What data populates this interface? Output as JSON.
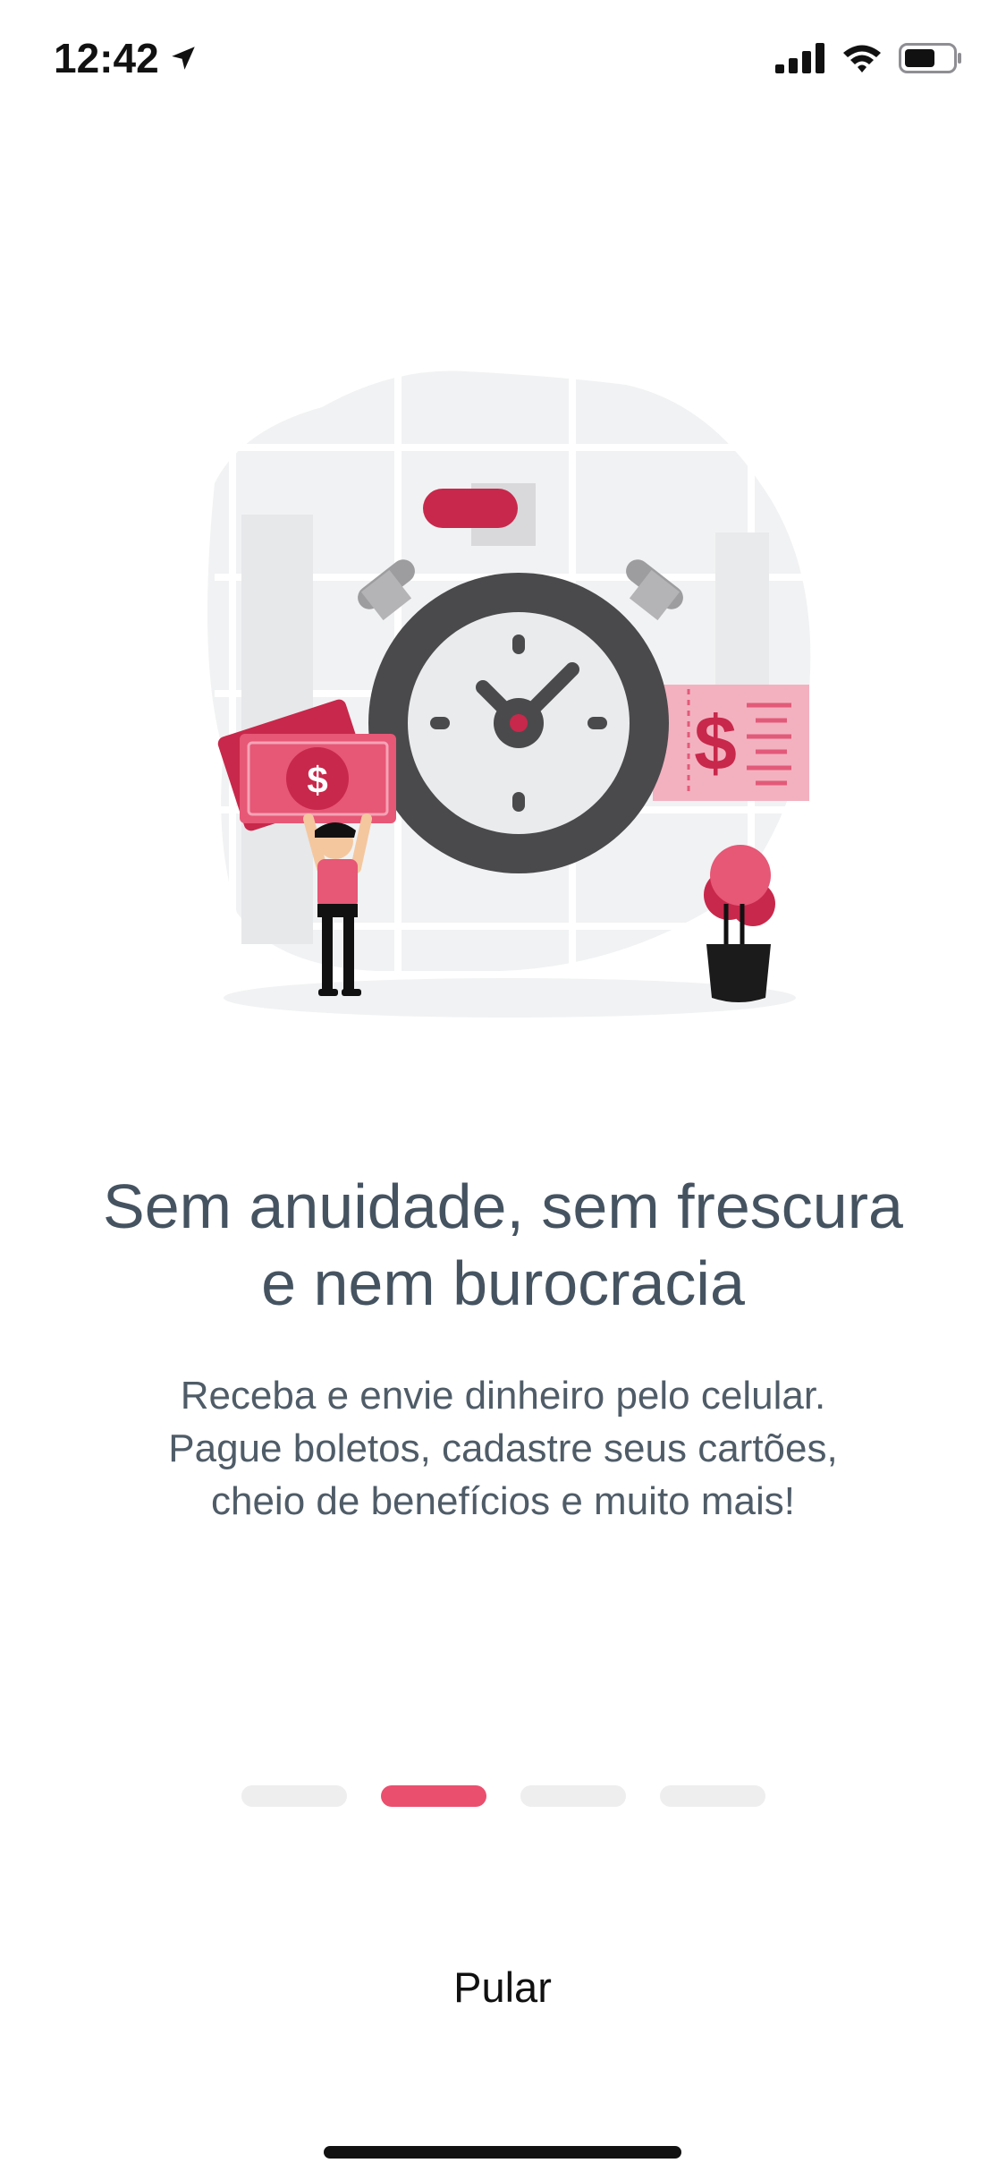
{
  "status_bar": {
    "time": "12:42",
    "icons": [
      "location-arrow-icon",
      "cellular-signal-icon",
      "wifi-icon",
      "battery-icon"
    ]
  },
  "illustration": {
    "name": "stopwatch-money-illustration",
    "accent_color": "#c8284b",
    "currency_symbol": "$"
  },
  "onboarding": {
    "headline_line1": "Sem anuidade, sem frescura",
    "headline_line2": "e nem burocracia",
    "body_line1": "Receba e envie dinheiro pelo celular.",
    "body_line2": "Pague boletos, cadastre seus cartões,",
    "body_line3": "cheio de benefícios e muito mais!"
  },
  "pager": {
    "total_pages": 4,
    "active_page": 2,
    "active_color": "#ea4f6e",
    "inactive_color": "#eeeeef"
  },
  "skip_button": {
    "label": "Pular"
  }
}
